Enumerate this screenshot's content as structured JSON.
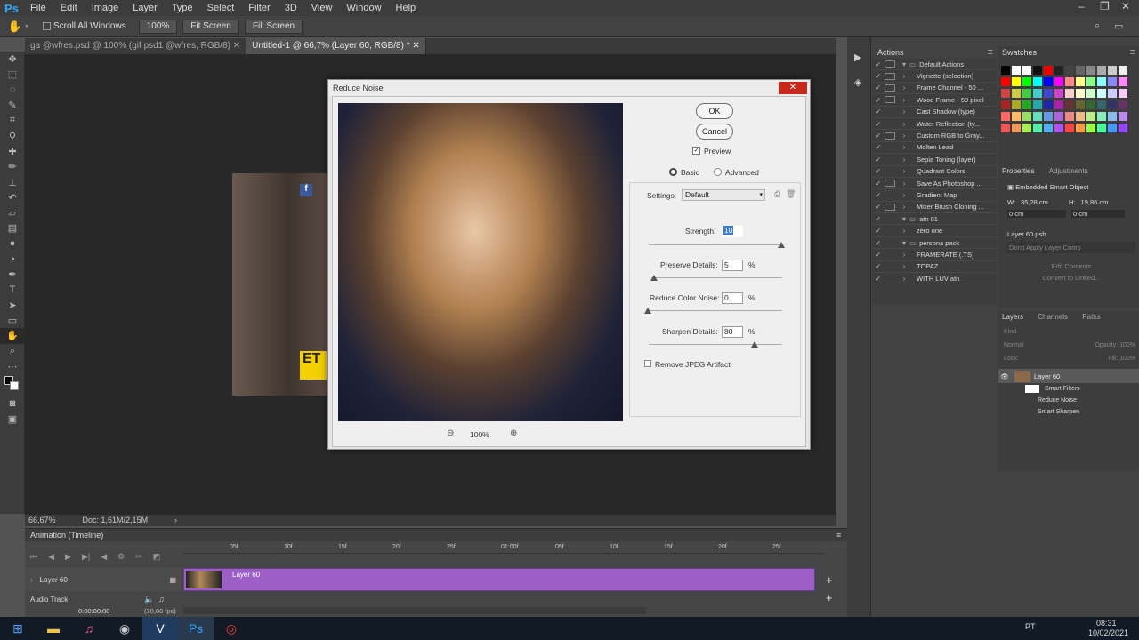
{
  "menubar": {
    "logo": "Ps",
    "items": [
      "File",
      "Edit",
      "Image",
      "Layer",
      "Type",
      "Select",
      "Filter",
      "3D",
      "View",
      "Window",
      "Help"
    ]
  },
  "optbar": {
    "scroll_all": "Scroll All Windows",
    "zoom_100": "100%",
    "fit_screen": "Fit Screen",
    "fill_screen": "Fill Screen"
  },
  "tabs": [
    {
      "label": "ga @wfres.psd @ 100% (gif psd1 @wfres, RGB/8)"
    },
    {
      "label": "Untitled-1 @ 66,7% (Layer 60, RGB/8) *"
    }
  ],
  "status": {
    "zoom": "66,67%",
    "doc": "Doc: 1,61M/2,15M"
  },
  "timeline": {
    "title": "Animation (Timeline)",
    "ticks": [
      "05f",
      "10f",
      "15f",
      "20f",
      "25f",
      "01:00f",
      "05f",
      "10f",
      "15f",
      "20f",
      "25f"
    ],
    "layer_name": "Layer 60",
    "clip_label": "Layer 60",
    "audio_track": "Audio Track",
    "timecode": "0:00:00:00",
    "fps": "(30,00 fps)"
  },
  "actions": {
    "tab_actions": "Actions",
    "items": [
      {
        "label": "Default Actions",
        "check": true,
        "dialog": true,
        "folder": true
      },
      {
        "label": "Vignette (selection)",
        "check": true,
        "dialog": true
      },
      {
        "label": "Frame Channel - 50 ...",
        "check": true,
        "dialog": true
      },
      {
        "label": "Wood Frame - 50 pixel",
        "check": true,
        "dialog": true
      },
      {
        "label": "Cast Shadow (type)",
        "check": true,
        "dialog": false
      },
      {
        "label": "Water Reflection (ty...",
        "check": true,
        "dialog": false
      },
      {
        "label": "Custom RGB to Gray...",
        "check": true,
        "dialog": true
      },
      {
        "label": "Molten Lead",
        "check": true,
        "dialog": false
      },
      {
        "label": "Sepia Toning (layer)",
        "check": true,
        "dialog": false
      },
      {
        "label": "Quadrant Colors",
        "check": true,
        "dialog": false
      },
      {
        "label": "Save As Photoshop ...",
        "check": true,
        "dialog": true
      },
      {
        "label": "Gradient Map",
        "check": true,
        "dialog": false
      },
      {
        "label": "Mixer Brush Cloning ...",
        "check": true,
        "dialog": true
      },
      {
        "label": "atn 01",
        "check": true,
        "dialog": false,
        "folder": true
      },
      {
        "label": "zero one",
        "check": true,
        "dialog": false
      },
      {
        "label": "persona pack",
        "check": true,
        "dialog": false,
        "folder": true
      },
      {
        "label": "FRAMERATE (.TS)",
        "check": true,
        "dialog": false
      },
      {
        "label": "TOPAZ",
        "check": true,
        "dialog": false
      },
      {
        "label": "WITH LUV atn",
        "check": true,
        "dialog": false
      }
    ]
  },
  "swatches": {
    "tab": "Swatches"
  },
  "properties": {
    "tab_properties": "Properties",
    "tab_adjustments": "Adjustments",
    "object_type": "Embedded Smart Object",
    "w_label": "W:",
    "w_value": "35,28 cm",
    "h_label": "H:",
    "h_value": "19,86 cm",
    "x_value": "0 cm",
    "y_value": "0 cm",
    "file_name": "Layer 60.psb",
    "layer_comp": "Don't Apply Layer Comp",
    "edit_contents": "Edit Contents",
    "convert_linked": "Convert to Linked..."
  },
  "layers": {
    "tab_layers": "Layers",
    "tab_channels": "Channels",
    "tab_paths": "Paths",
    "kind": "Kind",
    "blend": "Normal",
    "opacity_label": "Opacity:",
    "opacity": "100%",
    "lock_label": "Lock:",
    "fill_label": "Fill:",
    "fill": "100%",
    "layer_name": "Layer 60",
    "smart_filters": "Smart Filters",
    "filter1": "Reduce Noise",
    "filter2": "Smart Sharpen"
  },
  "dialog": {
    "title": "Reduce Noise",
    "ok": "OK",
    "cancel": "Cancel",
    "preview": "Preview",
    "basic": "Basic",
    "advanced": "Advanced",
    "settings_label": "Settings:",
    "settings_value": "Default",
    "strength_label": "Strength:",
    "strength_value": "10",
    "preserve_label": "Preserve Details:",
    "preserve_value": "5",
    "reduce_color_label": "Reduce Color Noise:",
    "reduce_color_value": "0",
    "sharpen_label": "Sharpen Details:",
    "sharpen_value": "80",
    "percent": "%",
    "jpeg_label": "Remove JPEG Artifact",
    "zoom": "100%"
  },
  "taskbar": {
    "lang": "PT",
    "time": "08:31",
    "date": "10/02/2021"
  }
}
